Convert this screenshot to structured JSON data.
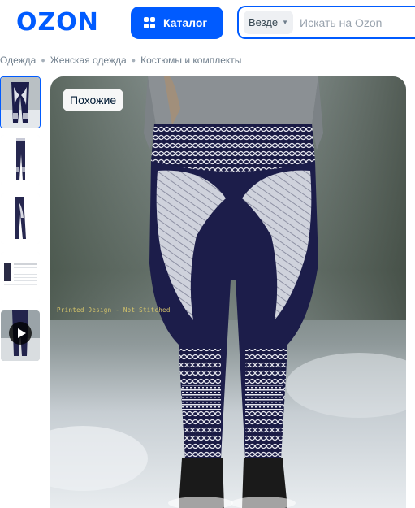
{
  "header": {
    "logo": "OZON",
    "catalog_label": "Каталог",
    "search": {
      "scope": "Везде",
      "placeholder": "Искать на Ozon"
    }
  },
  "breadcrumb": [
    "Одежда",
    "Женская одежда",
    "Костюмы и комплекты"
  ],
  "gallery": {
    "thumbnails": [
      {
        "type": "image",
        "active": true
      },
      {
        "type": "image",
        "active": false
      },
      {
        "type": "image",
        "active": false
      },
      {
        "type": "size-chart",
        "active": false
      },
      {
        "type": "video",
        "active": false
      }
    ],
    "similar_label": "Похожие",
    "image_caption": "Printed Design - Not Stitched"
  },
  "colors": {
    "brand": "#005bff",
    "leggings": "#1c1d4a",
    "pattern": "#e8e8ef"
  }
}
